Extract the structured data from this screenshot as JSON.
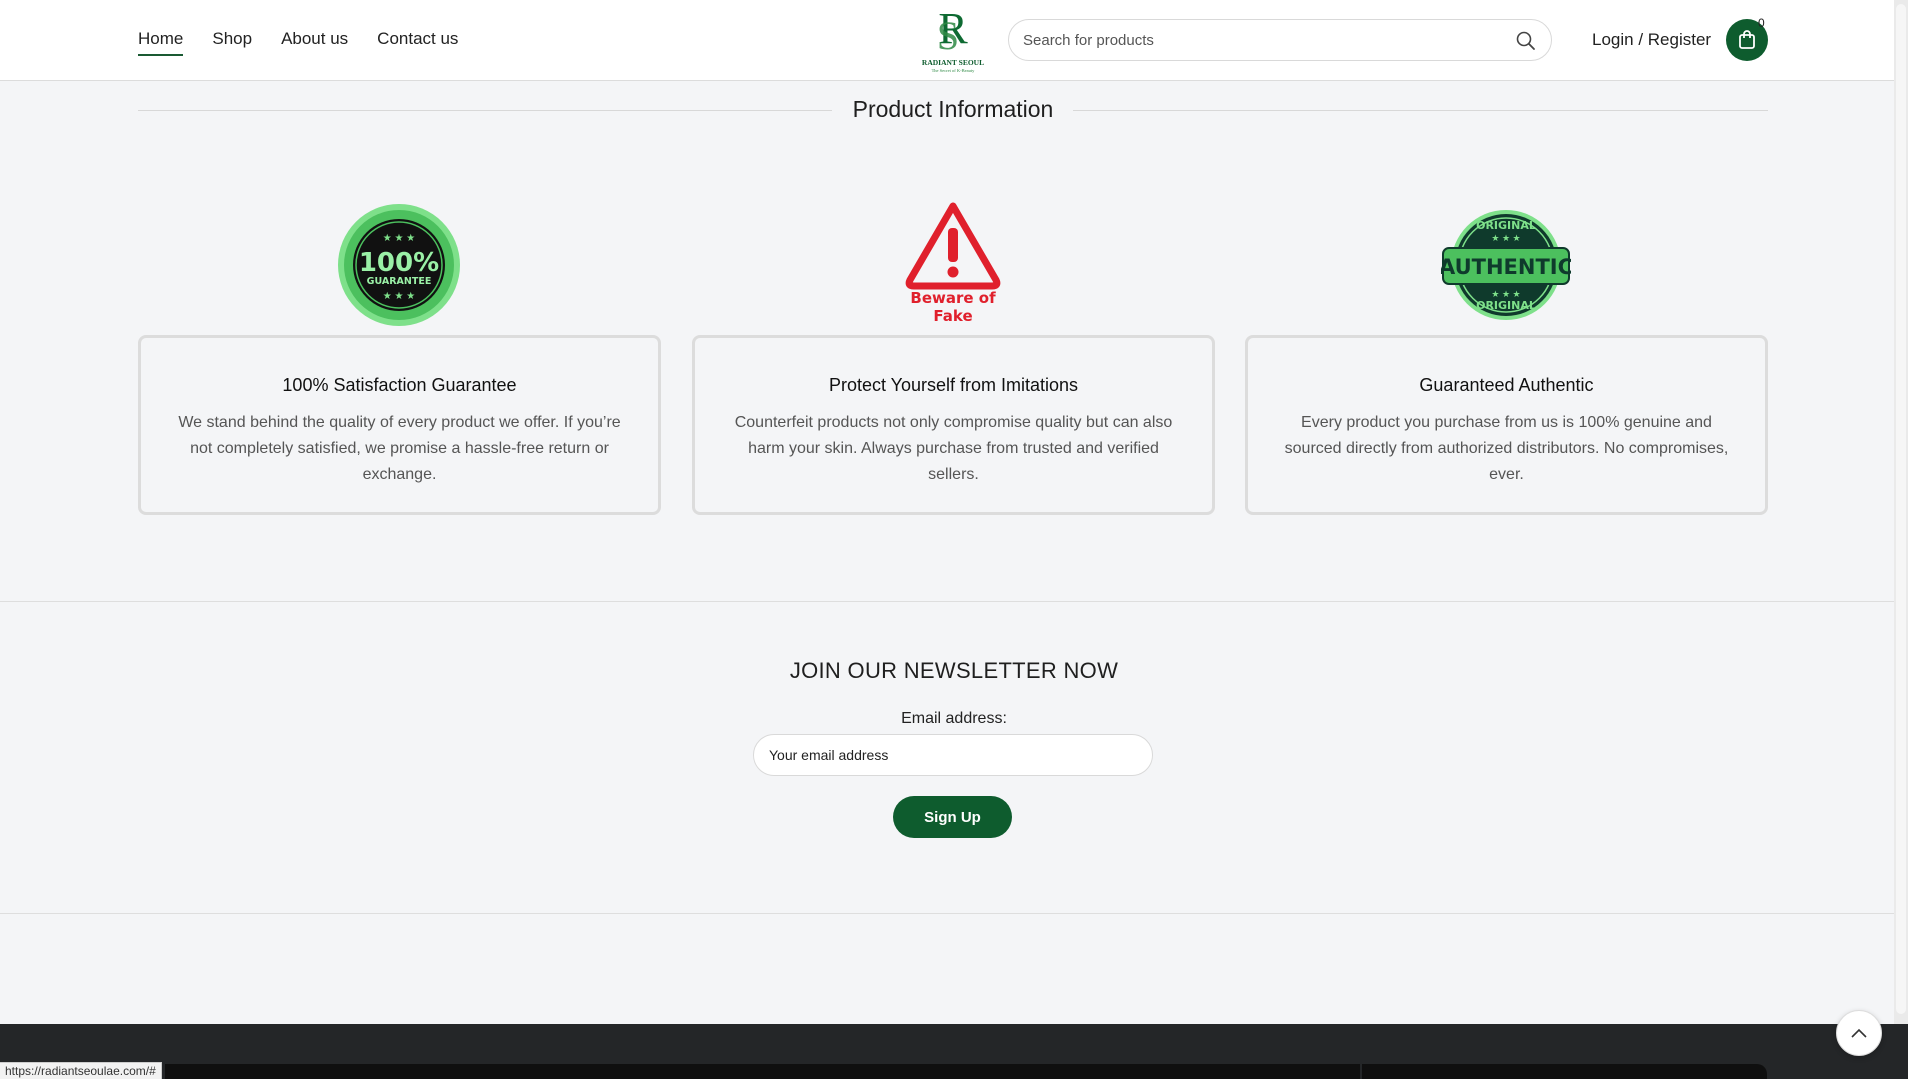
{
  "header": {
    "nav": [
      {
        "label": "Home",
        "active": true
      },
      {
        "label": "Shop"
      },
      {
        "label": "About us"
      },
      {
        "label": "Contact us"
      }
    ],
    "logo": {
      "brand": "RADIANT SEOUL",
      "tagline": "The Secret of K-Beauty"
    },
    "search": {
      "placeholder": "Search for products"
    },
    "login_label": "Login / Register",
    "cart_count": "0"
  },
  "product_info": {
    "title": "Product Information",
    "cards": [
      {
        "badge": {
          "big": "100%",
          "small": "GUARANTEE"
        },
        "title": "100% Satisfaction Guarantee",
        "text": "We stand behind the quality of every product we offer. If you’re not completely satisfied, we promise a hassle-free return or exchange."
      },
      {
        "badge": {
          "line1": "Beware of",
          "line2": "Fake"
        },
        "title": "Protect Yourself from Imitations",
        "text": "Counterfeit products not only compromise quality but can also harm your skin. Always purchase from trusted and verified sellers."
      },
      {
        "badge": {
          "big": "AUTHENTIC",
          "small": "ORIGINAL"
        },
        "title": "Guaranteed Authentic",
        "text": "Every product you purchase from us is 100% genuine and sourced directly from authorized distributors. No compromises, ever."
      }
    ]
  },
  "newsletter": {
    "title": "JOIN OUR NEWSLETTER NOW",
    "email_label": "Email address:",
    "email_placeholder": "Your email address",
    "button": "Sign Up"
  },
  "status_bar": {
    "url": "https://radiantseoulae.com/#"
  },
  "colors": {
    "brand_green": "#0e5c2e",
    "badge_green": "#5ecb6e",
    "warning_red": "#e0202c"
  },
  "icons": [
    "search-icon",
    "cart-icon",
    "chevron-up-icon"
  ]
}
